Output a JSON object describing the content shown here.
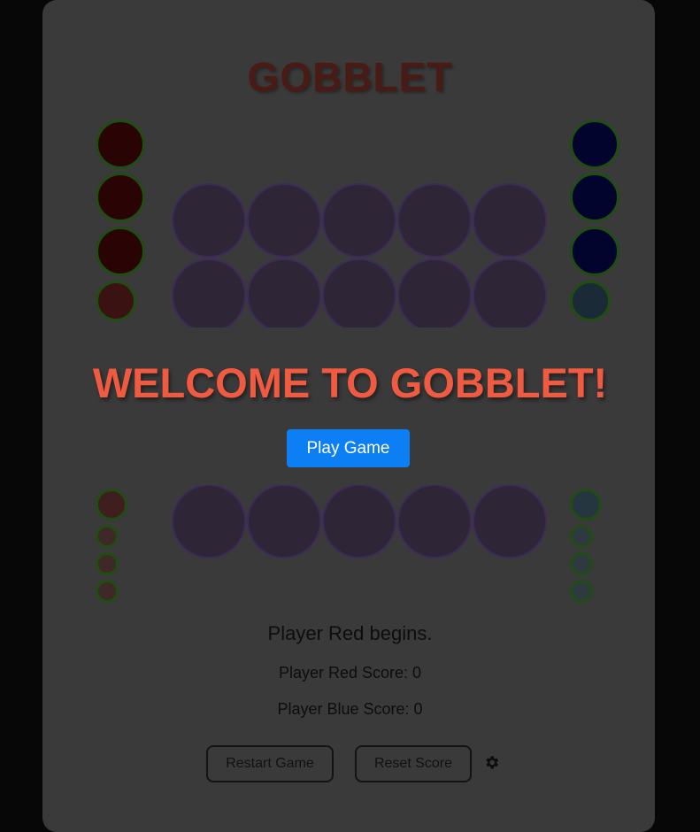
{
  "game": {
    "title": "GOBBLET",
    "overlay_title": "WELCOME TO GOBBLET!",
    "play_button": "Play Game",
    "status": "Player Red begins.",
    "red_score": "Player Red Score: 0",
    "blue_score": "Player Blue Score: 0",
    "restart_button": "Restart Game",
    "reset_button": "Reset Score",
    "settings_icon": "gear-icon"
  },
  "colors": {
    "red_piece": "#2a0404",
    "blue_piece": "#02042e",
    "cell": "#2e2536",
    "welcome": "#f05a40",
    "play_button": "#0d7ff5"
  }
}
